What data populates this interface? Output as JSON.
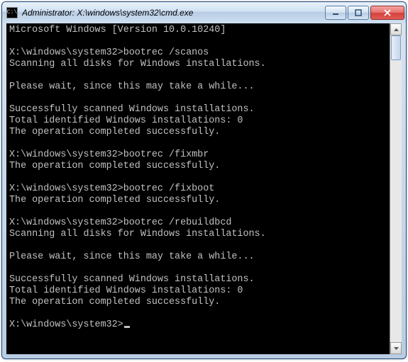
{
  "window": {
    "title": "Administrator: X:\\windows\\system32\\cmd.exe"
  },
  "terminal": {
    "lines": [
      "Microsoft Windows [Version 10.0.10240]",
      "",
      "X:\\windows\\system32>bootrec /scanos",
      "Scanning all disks for Windows installations.",
      "",
      "Please wait, since this may take a while...",
      "",
      "Successfully scanned Windows installations.",
      "Total identified Windows installations: 0",
      "The operation completed successfully.",
      "",
      "X:\\windows\\system32>bootrec /fixmbr",
      "The operation completed successfully.",
      "",
      "X:\\windows\\system32>bootrec /fixboot",
      "The operation completed successfully.",
      "",
      "X:\\windows\\system32>bootrec /rebuildbcd",
      "Scanning all disks for Windows installations.",
      "",
      "Please wait, since this may take a while...",
      "",
      "Successfully scanned Windows installations.",
      "Total identified Windows installations: 0",
      "The operation completed successfully.",
      ""
    ],
    "prompt": "X:\\windows\\system32>"
  }
}
